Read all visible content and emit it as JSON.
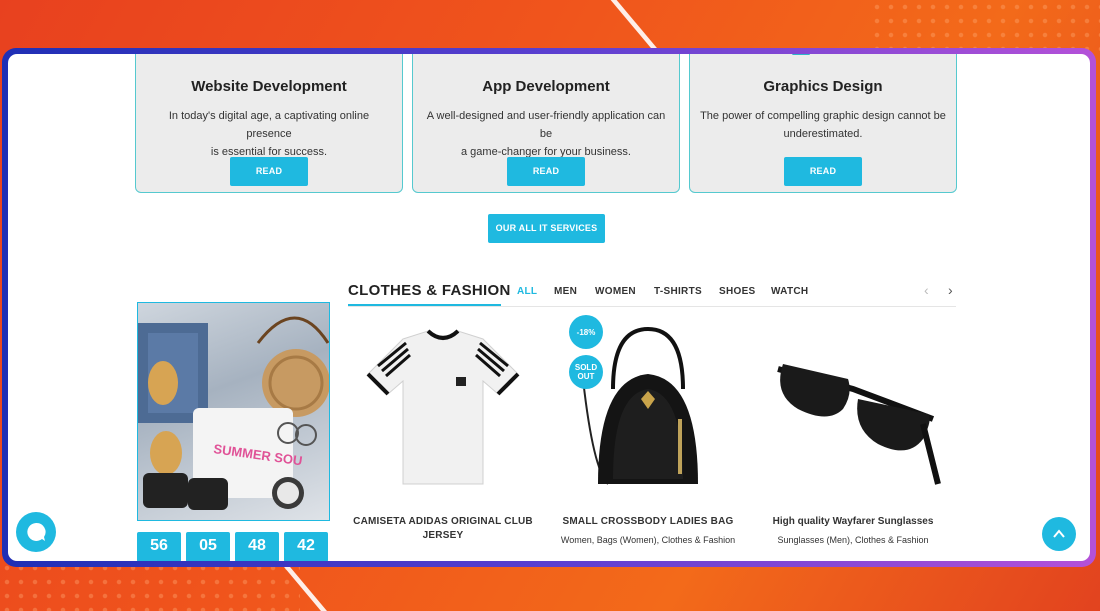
{
  "services": [
    {
      "title": "Website Development",
      "desc_line1": "In today's digital age, a captivating online presence",
      "desc_line2": "is essential for success.",
      "button": "READ MORE"
    },
    {
      "title": "App Development",
      "desc_line1": "A well-designed and user-friendly application can be",
      "desc_line2": "a game-changer for your business.",
      "button": "READ MORE"
    },
    {
      "title": "Graphics Design",
      "desc_line1": "The power of compelling graphic design cannot be",
      "desc_line2": "underestimated.",
      "button": "READ MORE"
    }
  ],
  "all_services_button": "OUR ALL IT SERVICES",
  "fashion": {
    "title": "CLOTHES & FASHION",
    "tabs": [
      "ALL",
      "MEN",
      "WOMEN",
      "T-SHIRTS",
      "SHOES",
      "WATCH"
    ],
    "active_tab": "ALL",
    "promo_text": "SUMMER SOU",
    "countdown": [
      "56",
      "05",
      "48",
      "42"
    ],
    "products": [
      {
        "name_line1": "CAMISETA ADIDAS ORIGINAL CLUB",
        "name_line2": "JERSEY",
        "categories": ""
      },
      {
        "name_line1": "SMALL CROSSBODY LADIES BAG",
        "name_line2": "",
        "categories": "Women, Bags (Women), Clothes & Fashion",
        "discount_badge": "-18%",
        "sold_badge": "SOLD OUT"
      },
      {
        "name_line1": "High quality Wayfarer Sunglasses",
        "name_line2": "",
        "categories": "Sunglasses (Men), Clothes & Fashion"
      }
    ]
  },
  "colors": {
    "accent": "#1fb9e0",
    "frame_start": "#1f2fb5",
    "frame_end": "#b451d8",
    "background": "#ee4f1e"
  }
}
